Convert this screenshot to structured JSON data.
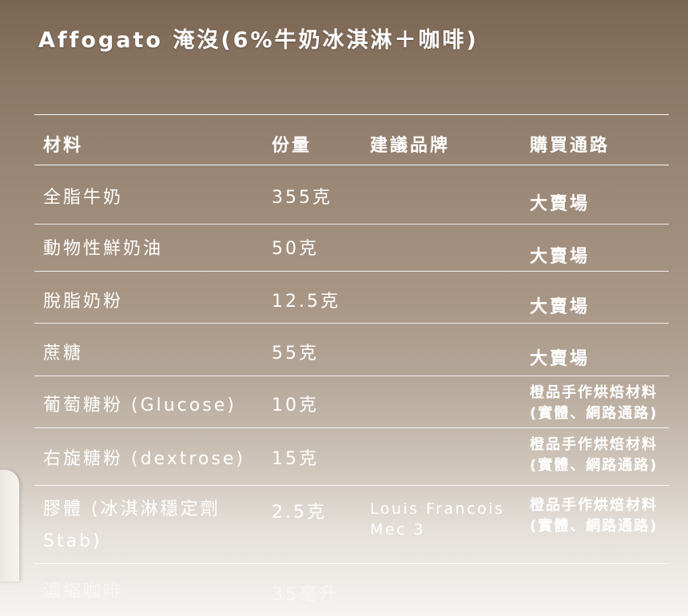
{
  "title": "Affogato 淹沒(6%牛奶冰淇淋＋咖啡)",
  "table": {
    "headers": {
      "material": "材料",
      "amount": "份量",
      "brand": "建議品牌",
      "channel": "購買通路"
    },
    "rows": [
      {
        "material": "全脂牛奶",
        "amount": "355克",
        "brand": "",
        "channel": "大賣場"
      },
      {
        "material": "動物性鮮奶油",
        "amount": "50克",
        "brand": "",
        "channel": "大賣場"
      },
      {
        "material": "脫脂奶粉",
        "amount": "12.5克",
        "brand": "",
        "channel": "大賣場"
      },
      {
        "material": "蔗糖",
        "amount": "55克",
        "brand": "",
        "channel": "大賣場"
      },
      {
        "material": "葡萄糖粉 (Glucose)",
        "amount": "10克",
        "brand": "",
        "channel": "橙品手作烘焙材料 (實體、網路通路)"
      },
      {
        "material": "右旋糖粉 (dextrose)",
        "amount": "15克",
        "brand": "",
        "channel": "橙品手作烘焙材料 (實體、網路通路)"
      },
      {
        "material": "膠體 (冰淇淋穩定劑 Stab)",
        "amount": "2.5克",
        "brand": "Louis Francois Mec 3",
        "channel": "橙品手作烘焙材料 (實體、網路通路)"
      },
      {
        "material": "濃縮咖啡",
        "amount": "35毫升",
        "brand": "",
        "channel": ""
      }
    ]
  }
}
